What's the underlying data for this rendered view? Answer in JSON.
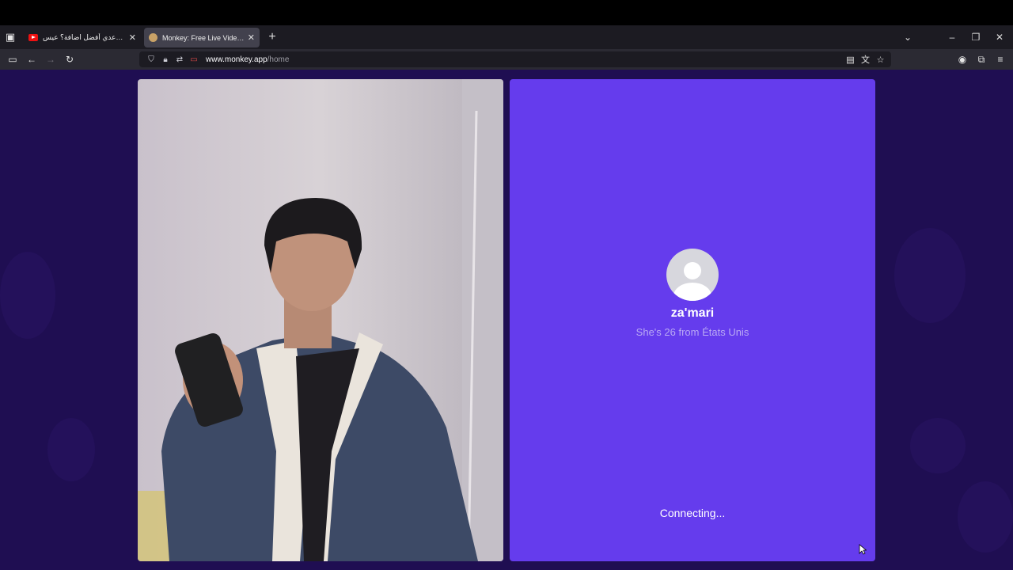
{
  "browser": {
    "tabs": [
      {
        "title": "أيوب بوعدي أفضل اضافة؟ عيس",
        "favicon": "youtube-icon",
        "active": false
      },
      {
        "title": "Monkey: Free Live Video Chat",
        "favicon": "monkey-icon",
        "active": true
      }
    ],
    "url": {
      "host": "www.monkey.app",
      "path": "/home"
    }
  },
  "call": {
    "remote_user": {
      "name": "za'mari",
      "info": "She's 26 from États Unis"
    },
    "status": "Connecting..."
  },
  "colors": {
    "page_background": "#1f0e52",
    "remote_panel": "#653ced",
    "tab_active": "#42414d"
  }
}
